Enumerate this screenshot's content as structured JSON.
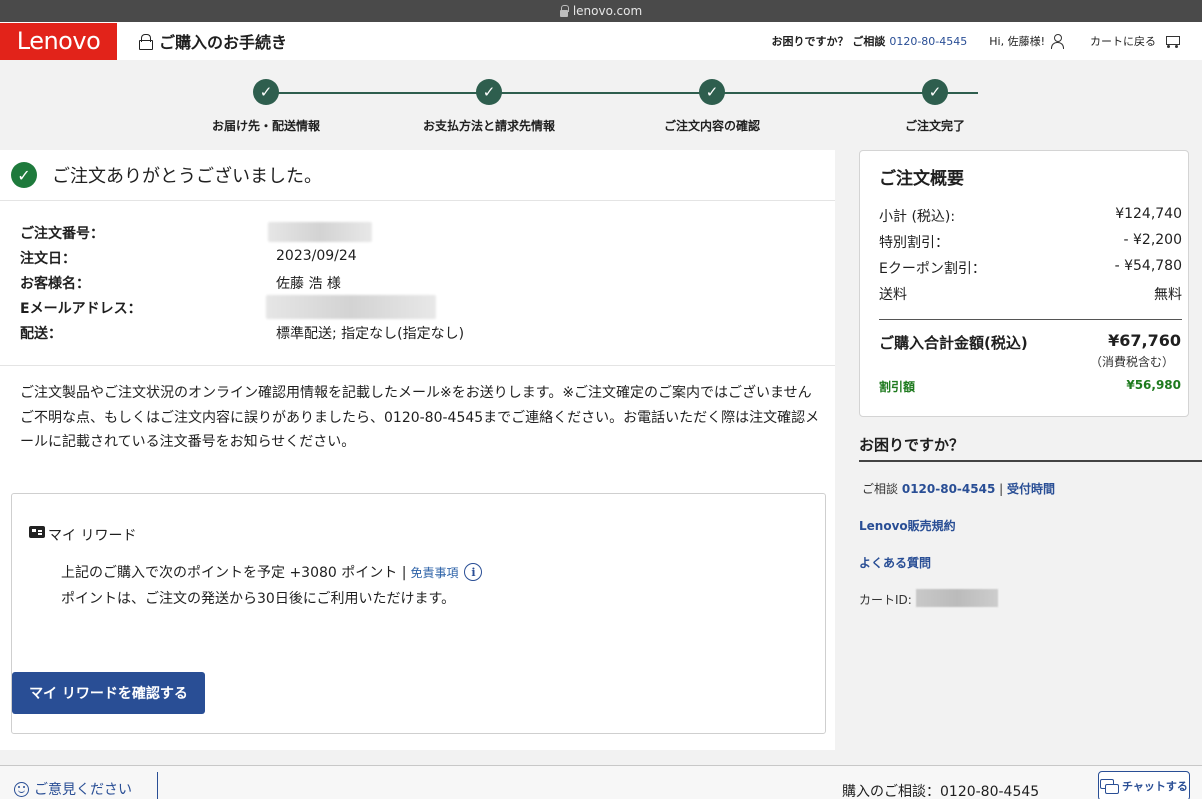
{
  "browser": {
    "url": "lenovo.com"
  },
  "header": {
    "logo": "Lenovo",
    "title": "ご購入のお手続き",
    "help_text": "お困りですか？ ご相談",
    "help_phone": "0120-80-4545",
    "greeting": "Hi, 佐藤様!",
    "cart_link": "カートに戻る"
  },
  "steps": [
    {
      "label": "お届け先・配送情報",
      "status": "completed"
    },
    {
      "label": "お支払方法と請求先情報",
      "status": "completed"
    },
    {
      "label": "ご注文内容の確認",
      "status": "completed"
    },
    {
      "label": "ご注文完了",
      "status": "completed"
    }
  ],
  "confirmation": {
    "message": "ご注文ありがとうございました。",
    "fields": {
      "order_number_label": "ご注文番号：",
      "order_date_label": "注文日：",
      "order_date": "2023/09/24",
      "customer_label": "お客様名：",
      "customer_name": "佐藤 浩 様",
      "email_label": "Eメールアドレス：",
      "delivery_label": "配送：",
      "delivery": "標準配送; 指定なし(指定なし)"
    },
    "notice": "ご注文製品やご注文状況のオンライン確認用情報を記載したメール※をお送りします。※ご注文確定のご案内ではございませんご不明な点、もしくはご注文内容に誤りがありましたら、0120-80-4545までご連絡ください。お電話いただく際は注文確認メールに記載されている注文番号をお知らせください。"
  },
  "rewards": {
    "title": "マイ リワード",
    "points_text": "上記のご購入で次のポイントを予定 +3080 ポイント |",
    "disclaimer_link": "免責事項",
    "availability_text": "ポイントは、ご注文の発送から30日後にご利用いただけます。",
    "button_label": "マイ リワードを確認する"
  },
  "summary": {
    "title": "ご注文概要",
    "rows": [
      {
        "label": "小計 (税込):",
        "value": "¥124,740"
      },
      {
        "label": "特別割引：",
        "value": "- ¥2,200"
      },
      {
        "label": "Eクーポン割引：",
        "value": "- ¥54,780"
      },
      {
        "label": "送料",
        "value": "無料"
      }
    ],
    "total_label": "ご購入合計金額(税込)",
    "total_value": "¥67,760",
    "tax_note": "（消費税含む）",
    "discount_label": "割引額",
    "discount_value": "¥56,980",
    "discount_color": "#1e7a1e"
  },
  "help": {
    "title": "お困りですか？",
    "contact_prefix": "ご相談",
    "contact_phone": "0120-80-4545",
    "separator": "|",
    "hours_link": "受付時間",
    "terms_link": "Lenovo販売規約",
    "faq_link": "よくある質問",
    "cart_id_label": "カートID:"
  },
  "footer": {
    "feedback": "ご意見ください",
    "phone_text": "購入のご相談：0120-80-4545",
    "chat_button": "チャットする"
  },
  "colors": {
    "brand_red": "#e2231a",
    "step_green": "#2e5e4e",
    "link_blue": "#294e95",
    "button_blue": "#294e95"
  }
}
